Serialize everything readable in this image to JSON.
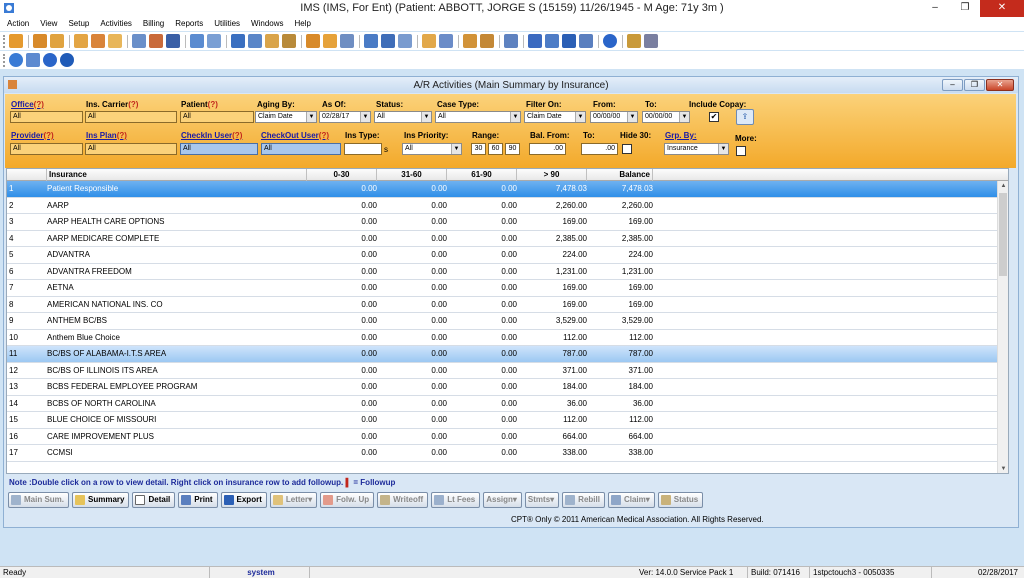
{
  "window": {
    "title": "IMS (IMS, For Ent)    (Patient: ABBOTT, JORGE S (15159) 11/26/1945 - M Age: 71y 3m )",
    "minimize": "–",
    "restore": "❐",
    "close": "✕"
  },
  "menu": [
    "Action",
    "View",
    "Setup",
    "Activities",
    "Billing",
    "Reports",
    "Utilities",
    "Windows",
    "Help"
  ],
  "child": {
    "title": "A/R Activities  (Main Summary by Insurance)",
    "minimize": "–",
    "restore": "❐",
    "close": "✕"
  },
  "filters": {
    "office_label": "Office",
    "office_value": "All",
    "ins_carrier_label": "Ins. Carrier",
    "ins_carrier_value": "All",
    "patient_label": "Patient",
    "patient_value": "All",
    "aging_by_label": "Aging By:",
    "aging_by_value": "Claim Date",
    "as_of_label": "As Of:",
    "as_of_value": "02/28/17",
    "status_label": "Status:",
    "status_value": "All",
    "case_type_label": "Case Type:",
    "case_type_value": "All",
    "filter_on_label": "Filter On:",
    "filter_on_value": "Claim Date",
    "from_label": "From:",
    "from_value": "00/00/00",
    "to_label": "To:",
    "to_value": "00/00/00",
    "include_copay_label": "Include Copay:",
    "include_copay_checked": "✔",
    "provider_label": "Provider",
    "provider_value": "All",
    "ins_plan_label": "Ins Plan",
    "ins_plan_value": "All",
    "checkin_user_label": "CheckIn User",
    "checkin_user_value": "All",
    "checkout_user_label": "CheckOut User",
    "checkout_user_value": "All",
    "ins_type_label": "Ins Type:",
    "ins_type_value": "",
    "ins_type_suffix": "s",
    "ins_priority_label": "Ins Priority:",
    "ins_priority_value": "All",
    "range_label": "Range:",
    "range_values": [
      "30",
      "60",
      "90"
    ],
    "bal_from_label": "Bal. From:",
    "bal_from_value": ".00",
    "bal_to_label": "To:",
    "bal_to_value": ".00",
    "hide30_label": "Hide 30:",
    "grp_by_label": "Grp. By:",
    "grp_by_value": "Insurance",
    "more_label": "More:",
    "help_mark": "(?)"
  },
  "grid": {
    "columns": [
      "Insurance",
      "0-30",
      "31-60",
      "61-90",
      "> 90",
      "Balance"
    ],
    "rows": [
      {
        "n": "1",
        "ins": "Patient Responsible",
        "a": "0.00",
        "b": "0.00",
        "c": "0.00",
        "d": "7,478.03",
        "e": "7,478.03"
      },
      {
        "n": "2",
        "ins": "AARP",
        "a": "0.00",
        "b": "0.00",
        "c": "0.00",
        "d": "2,260.00",
        "e": "2,260.00"
      },
      {
        "n": "3",
        "ins": "AARP HEALTH CARE OPTIONS",
        "a": "0.00",
        "b": "0.00",
        "c": "0.00",
        "d": "169.00",
        "e": "169.00"
      },
      {
        "n": "4",
        "ins": "AARP MEDICARE COMPLETE",
        "a": "0.00",
        "b": "0.00",
        "c": "0.00",
        "d": "2,385.00",
        "e": "2,385.00"
      },
      {
        "n": "5",
        "ins": "ADVANTRA",
        "a": "0.00",
        "b": "0.00",
        "c": "0.00",
        "d": "224.00",
        "e": "224.00"
      },
      {
        "n": "6",
        "ins": "ADVANTRA FREEDOM",
        "a": "0.00",
        "b": "0.00",
        "c": "0.00",
        "d": "1,231.00",
        "e": "1,231.00"
      },
      {
        "n": "7",
        "ins": "AETNA",
        "a": "0.00",
        "b": "0.00",
        "c": "0.00",
        "d": "169.00",
        "e": "169.00"
      },
      {
        "n": "8",
        "ins": "AMERICAN NATIONAL INS. CO",
        "a": "0.00",
        "b": "0.00",
        "c": "0.00",
        "d": "169.00",
        "e": "169.00"
      },
      {
        "n": "9",
        "ins": "ANTHEM BC/BS",
        "a": "0.00",
        "b": "0.00",
        "c": "0.00",
        "d": "3,529.00",
        "e": "3,529.00"
      },
      {
        "n": "10",
        "ins": "Anthem Blue Choice",
        "a": "0.00",
        "b": "0.00",
        "c": "0.00",
        "d": "112.00",
        "e": "112.00"
      },
      {
        "n": "11",
        "ins": "BC/BS OF ALABAMA-I.T.S AREA",
        "a": "0.00",
        "b": "0.00",
        "c": "0.00",
        "d": "787.00",
        "e": "787.00"
      },
      {
        "n": "12",
        "ins": "BC/BS OF ILLINOIS ITS AREA",
        "a": "0.00",
        "b": "0.00",
        "c": "0.00",
        "d": "371.00",
        "e": "371.00"
      },
      {
        "n": "13",
        "ins": "BCBS FEDERAL EMPLOYEE PROGRAM",
        "a": "0.00",
        "b": "0.00",
        "c": "0.00",
        "d": "184.00",
        "e": "184.00"
      },
      {
        "n": "14",
        "ins": "BCBS OF NORTH CAROLINA",
        "a": "0.00",
        "b": "0.00",
        "c": "0.00",
        "d": "36.00",
        "e": "36.00"
      },
      {
        "n": "15",
        "ins": "BLUE CHOICE OF MISSOURI",
        "a": "0.00",
        "b": "0.00",
        "c": "0.00",
        "d": "112.00",
        "e": "112.00"
      },
      {
        "n": "16",
        "ins": "CARE IMPROVEMENT PLUS",
        "a": "0.00",
        "b": "0.00",
        "c": "0.00",
        "d": "664.00",
        "e": "664.00"
      },
      {
        "n": "17",
        "ins": "CCMSI",
        "a": "0.00",
        "b": "0.00",
        "c": "0.00",
        "d": "338.00",
        "e": "338.00"
      }
    ]
  },
  "note": {
    "text": "Note :Double click on a row to view detail. Right click on insurance row to add followup.",
    "flag_glyph": "▌",
    "flag_text": " = Followup"
  },
  "buttons": {
    "main_sum": "Main Sum.",
    "summary": "Summary",
    "detail": "Detail",
    "print": "Print",
    "export": "Export",
    "letter": "Letter",
    "folw_up": "Folw. Up",
    "writeoff": "Writeoff",
    "lt_fees": "Lt Fees",
    "assign": "Assign",
    "stmts": "Stmts",
    "rebill": "Rebill",
    "claim": "Claim",
    "status": "Status"
  },
  "copyright": "CPT® Only © 2011 American Medical Association.  All Rights Reserved.",
  "statusbar": {
    "ready": "Ready",
    "user": "system",
    "version": "Ver: 14.0.0 Service Pack 1",
    "build": "Build: 071416",
    "server": "1stpctouch3 - 0050335",
    "date": "02/28/2017"
  },
  "colors": {
    "filter_panel": "#f3a92a",
    "selected_row": "#2f8fe8",
    "highlight_row": "#9cc8f2",
    "help_mark": "#c2271c",
    "close_button": "#c42b1c"
  }
}
